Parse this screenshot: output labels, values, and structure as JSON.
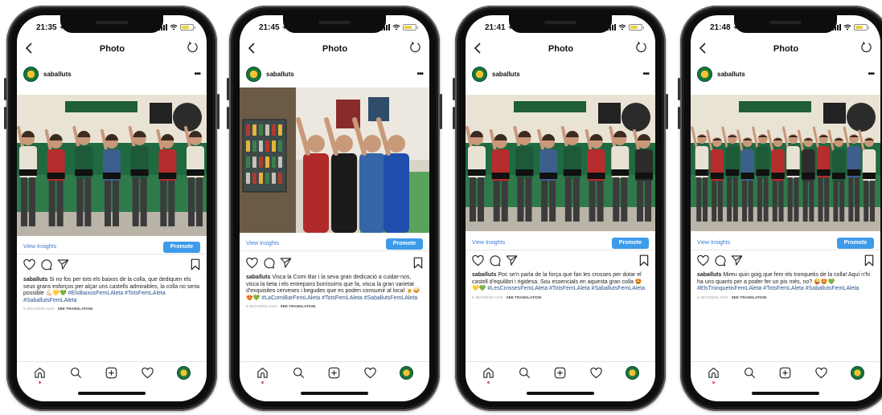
{
  "phones": [
    {
      "time": "21:35",
      "title": "Photo",
      "username": "saballuts",
      "view_insights": "View Insights",
      "promote": "Promote",
      "caption_user": "saballuts",
      "caption_text": "Si no fos per tots els baixos de la colla, que dediquen els seus grans esforços per alçar uns castells admirables, la colla no seria possible 💪🏻💛💚",
      "hashtags": "#ElsBaixosFemLAleta #TotsFemLAleta #SaballutsFemLAleta",
      "timestamp": "6 SECONDS AGO",
      "see_translation": "SEE TRANSLATION"
    },
    {
      "time": "21:45",
      "title": "Photo",
      "username": "saballuts",
      "view_insights": "View Insights",
      "promote": "Promote",
      "caption_user": "saballuts",
      "caption_text": "Visca la Comi Bar i la seva gran dedicació a cuidar-nos, visca la tieta i els entrepans boníssims que fa, visca la gran varietat d'exquisites cerveses i begudes que es poden consumir al local 🍺🥪😍💚",
      "hashtags": "#LaComiBarFemLAleta #TotsFemLAleta #SaballutsFemLAleta",
      "timestamp": "6 SECONDS AGO",
      "see_translation": "SEE TRANSLATION"
    },
    {
      "time": "21:41",
      "title": "Photo",
      "username": "saballuts",
      "view_insights": "View Insights",
      "promote": "Promote",
      "caption_user": "saballuts",
      "caption_text": "Poc se'n parla de la força que fan les crosses per dotar el castell d'equilibri i rigidesa. Sou essencials en aquesta gran colla 🤩💛💚",
      "hashtags": "#LesCrossesFemLAleta #TotsFemLAleta #SaballutsFemLAleta",
      "timestamp": "5 SECONDS AGO",
      "see_translation": "SEE TRANSLATION"
    },
    {
      "time": "21:48",
      "title": "Photo",
      "username": "saballuts",
      "view_insights": "View Insights",
      "promote": "Promote",
      "caption_user": "saballuts",
      "caption_text": "Mireu quin goig que fem els tronquetis de la colla! Aquí n'hi ha uns quants per a poder fer un pis més, no? 😜🤩💚",
      "hashtags": "#ElsTronquetisFemLAleta #TotsFemLAleta #SaballutsFemLAleta",
      "timestamp": "6 SECONDS AGO",
      "see_translation": "SEE TRANSLATION"
    }
  ],
  "icons": {
    "back": "chevron-left-icon",
    "refresh": "refresh-icon",
    "more": "more-icon",
    "like": "heart-icon",
    "comment": "comment-icon",
    "share": "send-icon",
    "save": "bookmark-icon",
    "home": "home-icon",
    "search": "search-icon",
    "create": "add-post-icon",
    "activity": "heart-icon",
    "profile": "avatar"
  },
  "colors": {
    "link": "#3b7bd6",
    "promote": "#3d9be9",
    "notification_dot": "#ed4956",
    "brand_green": "#17753d",
    "brand_yellow": "#f4c22f"
  }
}
